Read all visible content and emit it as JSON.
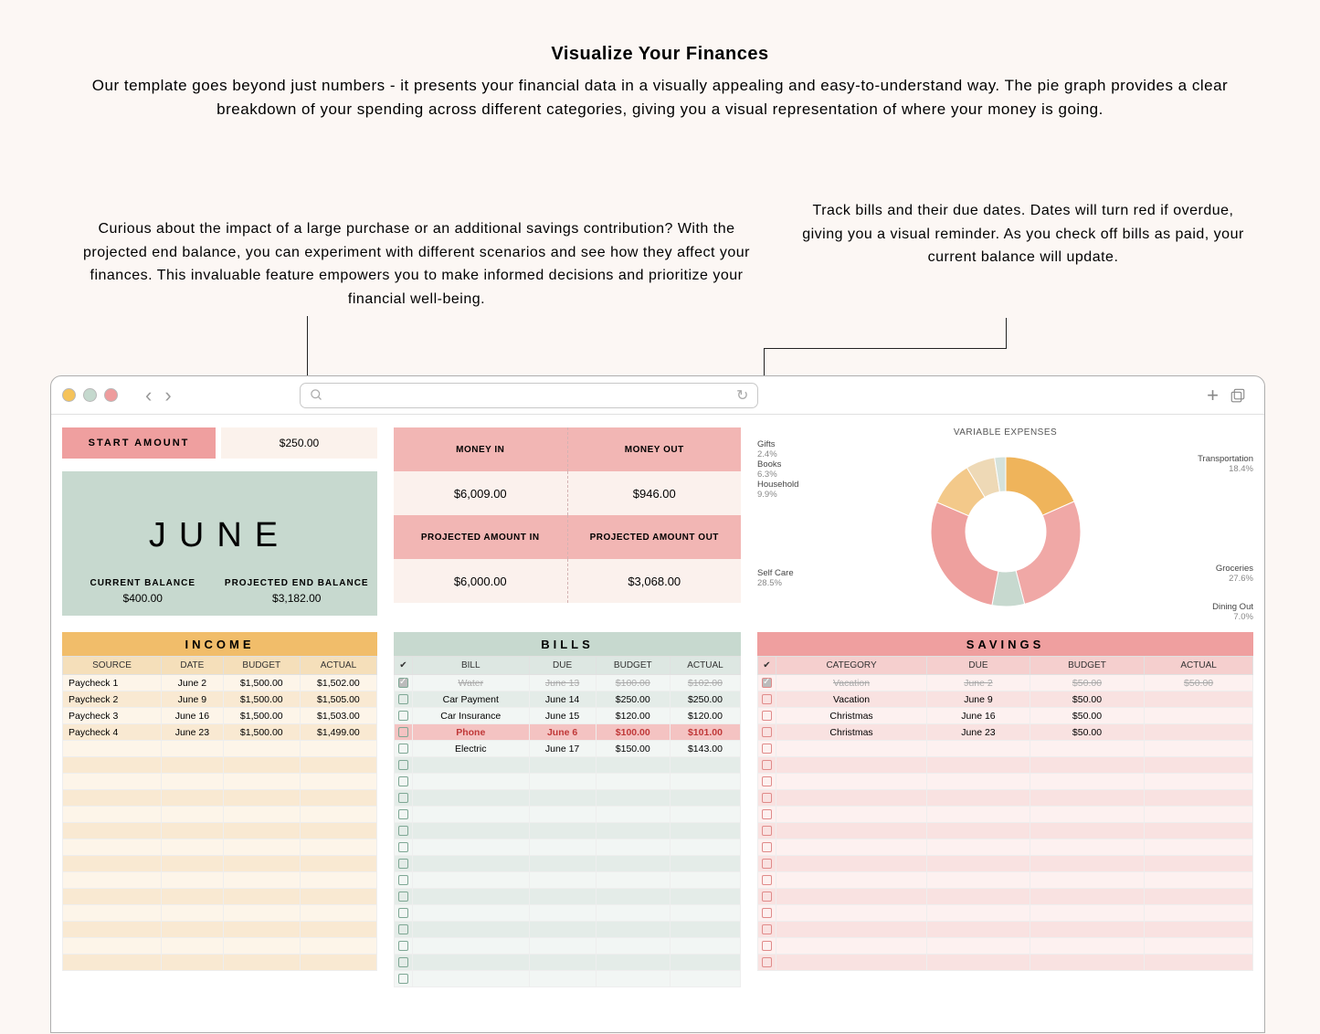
{
  "promo": {
    "title": "Visualize Your Finances",
    "body": "Our template goes beyond just numbers - it presents your financial data in a visually appealing and easy-to-understand way. The pie graph provides a clear breakdown of your spending across different categories, giving you a visual representation of where your money is going."
  },
  "annotation_left": "Curious about the impact of a large purchase or an additional savings contribution? With the projected end balance, you can experiment with different scenarios and see how they affect your finances. This invaluable feature empowers you to make informed decisions and prioritize your financial well-being.",
  "annotation_right": "Track bills and their due dates. Dates will turn red if overdue, giving you a visual reminder. As you check off bills as paid, your current balance will update.",
  "left": {
    "start_amount_label": "START AMOUNT",
    "start_amount_value": "$250.00",
    "month": "JUNE",
    "current_balance_label": "CURRENT BALANCE",
    "current_balance_value": "$400.00",
    "projected_end_label": "PROJECTED END BALANCE",
    "projected_end_value": "$3,182.00"
  },
  "mid": {
    "money_in_label": "MONEY IN",
    "money_out_label": "MONEY OUT",
    "money_in_value": "$6,009.00",
    "money_out_value": "$946.00",
    "proj_in_label": "PROJECTED AMOUNT IN",
    "proj_out_label": "PROJECTED AMOUNT OUT",
    "proj_in_value": "$6,000.00",
    "proj_out_value": "$3,068.00"
  },
  "chart_title": "VARIABLE EXPENSES",
  "chart_data": {
    "type": "pie",
    "title": "VARIABLE EXPENSES",
    "categories": [
      "Transportation",
      "Groceries",
      "Dining Out",
      "Self Care",
      "Household",
      "Books",
      "Gifts"
    ],
    "values": [
      18.4,
      27.6,
      7.0,
      28.5,
      9.9,
      6.3,
      2.4
    ],
    "colors": [
      "#efb45b",
      "#f0a8a6",
      "#c7d9cf",
      "#eea09e",
      "#f3c98a",
      "#eed9b6",
      "#d5e2db"
    ]
  },
  "chart_labels": {
    "transportation_name": "Transportation",
    "transportation_pct": "18.4%",
    "groceries_name": "Groceries",
    "groceries_pct": "27.6%",
    "dining_name": "Dining Out",
    "dining_pct": "7.0%",
    "selfcare_name": "Self Care",
    "selfcare_pct": "28.5%",
    "household_name": "Household",
    "household_pct": "9.9%",
    "books_name": "Books",
    "books_pct": "6.3%",
    "gifts_name": "Gifts",
    "gifts_pct": "2.4%"
  },
  "income": {
    "title": "INCOME",
    "headers": {
      "c0": "SOURCE",
      "c1": "DATE",
      "c2": "BUDGET",
      "c3": "ACTUAL"
    },
    "rows": [
      {
        "source": "Paycheck 1",
        "date": "June 2",
        "budget": "$1,500.00",
        "actual": "$1,502.00"
      },
      {
        "source": "Paycheck 2",
        "date": "June 9",
        "budget": "$1,500.00",
        "actual": "$1,505.00"
      },
      {
        "source": "Paycheck 3",
        "date": "June 16",
        "budget": "$1,500.00",
        "actual": "$1,503.00"
      },
      {
        "source": "Paycheck 4",
        "date": "June 23",
        "budget": "$1,500.00",
        "actual": "$1,499.00"
      }
    ],
    "empty_rows": 14
  },
  "bills": {
    "title": "BILLS",
    "headers": {
      "chk": "✔",
      "c0": "BILL",
      "c1": "DUE",
      "c2": "BUDGET",
      "c3": "ACTUAL"
    },
    "rows": [
      {
        "done": true,
        "bill": "Water",
        "due": "June 13",
        "budget": "$100.00",
        "actual": "$102.00",
        "struck": true
      },
      {
        "done": false,
        "bill": "Car Payment",
        "due": "June 14",
        "budget": "$250.00",
        "actual": "$250.00"
      },
      {
        "done": false,
        "bill": "Car Insurance",
        "due": "June 15",
        "budget": "$120.00",
        "actual": "$120.00"
      },
      {
        "done": false,
        "bill": "Phone",
        "due": "June 6",
        "budget": "$100.00",
        "actual": "$101.00",
        "overdue": true
      },
      {
        "done": false,
        "bill": "Electric",
        "due": "June 17",
        "budget": "$150.00",
        "actual": "$143.00"
      }
    ],
    "empty_rows": 14
  },
  "savings": {
    "title": "SAVINGS",
    "headers": {
      "chk": "✔",
      "c0": "CATEGORY",
      "c1": "DUE",
      "c2": "BUDGET",
      "c3": "ACTUAL"
    },
    "rows": [
      {
        "done": true,
        "cat": "Vacation",
        "due": "June 2",
        "budget": "$50.00",
        "actual": "$50.00",
        "struck": true
      },
      {
        "done": false,
        "cat": "Vacation",
        "due": "June 9",
        "budget": "$50.00",
        "actual": ""
      },
      {
        "done": false,
        "cat": "Christmas",
        "due": "June 16",
        "budget": "$50.00",
        "actual": ""
      },
      {
        "done": false,
        "cat": "Christmas",
        "due": "June 23",
        "budget": "$50.00",
        "actual": ""
      }
    ],
    "empty_rows": 14
  }
}
